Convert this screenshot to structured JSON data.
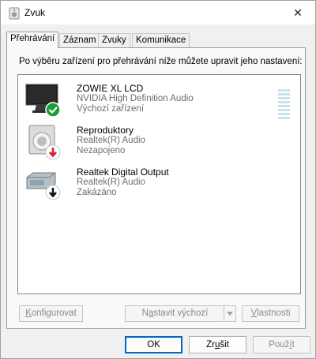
{
  "window": {
    "title": "Zvuk",
    "close_glyph": "✕"
  },
  "tabs": [
    {
      "label": "Přehrávání",
      "active": true
    },
    {
      "label": "Záznam",
      "active": false
    },
    {
      "label": "Zvuky",
      "active": false
    },
    {
      "label": "Komunikace",
      "active": false
    }
  ],
  "playback": {
    "description": "Po výběru zařízení pro přehrávání níže můžete upravit jeho nastavení:",
    "devices": [
      {
        "name": "ZOWIE XL LCD",
        "driver": "NVIDIA High Definition Audio",
        "status": "Výchozí zařízení",
        "icon": "monitor-icon",
        "badge": "green-check-badge",
        "level": 0
      },
      {
        "name": "Reproduktory",
        "driver": "Realtek(R) Audio",
        "status": "Nezapojeno",
        "icon": "speaker-icon",
        "badge": "red-down-arrow-badge"
      },
      {
        "name": "Realtek Digital Output",
        "driver": "Realtek(R) Audio",
        "status": "Zakázáno",
        "icon": "digital-output-icon",
        "badge": "black-down-arrow-badge"
      }
    ],
    "buttons": {
      "configure_prefix": "K",
      "configure_rest": "onfigurovat",
      "set_default_pre": "N",
      "set_default_ul": "a",
      "set_default_post": "stavit výchozí",
      "properties_prefix": "V",
      "properties_rest": "lastnosti"
    }
  },
  "dialog_buttons": {
    "ok": "OK",
    "cancel_pre": "Zr",
    "cancel_ul": "u",
    "cancel_post": "šit",
    "apply_pre": "Použ",
    "apply_ul": "í",
    "apply_post": "t"
  },
  "colors": {
    "accent": "#0067c0",
    "default_check": "#1a9e3a",
    "error_badge": "#d0202a"
  }
}
